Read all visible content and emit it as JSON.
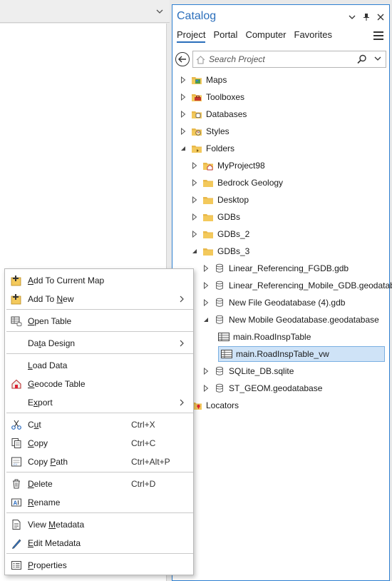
{
  "catalog": {
    "title": "Catalog",
    "tabs": [
      "Project",
      "Portal",
      "Computer",
      "Favorites"
    ],
    "active_tab": "Project",
    "search_placeholder": "Search Project",
    "tree": [
      {
        "label": "Maps",
        "icon": "maps-folder-icon",
        "expanded": false
      },
      {
        "label": "Toolboxes",
        "icon": "toolbox-folder-icon",
        "expanded": false
      },
      {
        "label": "Databases",
        "icon": "database-folder-icon",
        "expanded": false
      },
      {
        "label": "Styles",
        "icon": "styles-folder-icon",
        "expanded": false
      },
      {
        "label": "Folders",
        "icon": "folders-icon",
        "expanded": true
      },
      {
        "label": "MyProject98",
        "icon": "home-folder-icon",
        "expanded": false
      },
      {
        "label": "Bedrock Geology",
        "icon": "folder-icon",
        "expanded": false
      },
      {
        "label": "Desktop",
        "icon": "folder-icon",
        "expanded": false
      },
      {
        "label": "GDBs",
        "icon": "folder-icon",
        "expanded": false
      },
      {
        "label": "GDBs_2",
        "icon": "folder-icon",
        "expanded": false
      },
      {
        "label": "GDBs_3",
        "icon": "folder-icon",
        "expanded": true
      },
      {
        "label": "Linear_Referencing_FGDB.gdb",
        "icon": "geodatabase-icon",
        "expanded": false
      },
      {
        "label": "Linear_Referencing_Mobile_GDB.geodatabase",
        "icon": "geodatabase-icon",
        "expanded": false
      },
      {
        "label": "New File Geodatabase (4).gdb",
        "icon": "geodatabase-icon",
        "expanded": false
      },
      {
        "label": "New Mobile Geodatabase.geodatabase",
        "icon": "geodatabase-icon",
        "expanded": true
      },
      {
        "label": "main.RoadInspTable",
        "icon": "table-icon",
        "expanded": false
      },
      {
        "label": "main.RoadInspTable_vw",
        "icon": "table-icon",
        "selected": true
      },
      {
        "label": "SQLite_DB.sqlite",
        "icon": "geodatabase-icon",
        "expanded": false
      },
      {
        "label": "ST_GEOM.geodatabase",
        "icon": "geodatabase-icon",
        "expanded": false
      },
      {
        "label": "Locators",
        "icon": "locators-folder-icon",
        "expanded": false
      }
    ]
  },
  "context_menu": {
    "items": [
      {
        "pre": "",
        "ul": "A",
        "post": "dd To Current Map",
        "shortcut": "",
        "icon": "add-to-map-icon",
        "submenu": false
      },
      {
        "pre": "Add To ",
        "ul": "N",
        "post": "ew",
        "shortcut": "",
        "icon": "add-to-new-icon",
        "submenu": true
      },
      {
        "pre": "",
        "ul": "O",
        "post": "pen Table",
        "shortcut": "",
        "icon": "open-table-icon",
        "submenu": false
      },
      {
        "pre": "Da",
        "ul": "t",
        "post": "a Design",
        "shortcut": "",
        "icon": "",
        "submenu": true
      },
      {
        "pre": "",
        "ul": "L",
        "post": "oad Data",
        "shortcut": "",
        "icon": "",
        "submenu": false
      },
      {
        "pre": "",
        "ul": "G",
        "post": "eocode Table",
        "shortcut": "",
        "icon": "geocode-icon",
        "submenu": false
      },
      {
        "pre": "E",
        "ul": "x",
        "post": "port",
        "shortcut": "",
        "icon": "",
        "submenu": true
      },
      {
        "pre": "C",
        "ul": "u",
        "post": "t",
        "shortcut": "Ctrl+X",
        "icon": "cut-icon",
        "submenu": false
      },
      {
        "pre": "",
        "ul": "C",
        "post": "opy",
        "shortcut": "Ctrl+C",
        "icon": "copy-icon",
        "submenu": false
      },
      {
        "pre": "Copy ",
        "ul": "P",
        "post": "ath",
        "shortcut": "Ctrl+Alt+P",
        "icon": "copy-path-icon",
        "submenu": false
      },
      {
        "pre": "",
        "ul": "D",
        "post": "elete",
        "shortcut": "Ctrl+D",
        "icon": "delete-icon",
        "submenu": false
      },
      {
        "pre": "",
        "ul": "R",
        "post": "ename",
        "shortcut": "",
        "icon": "rename-icon",
        "submenu": false
      },
      {
        "pre": "View ",
        "ul": "M",
        "post": "etadata",
        "shortcut": "",
        "icon": "view-metadata-icon",
        "submenu": false
      },
      {
        "pre": "",
        "ul": "E",
        "post": "dit Metadata",
        "shortcut": "",
        "icon": "edit-metadata-icon",
        "submenu": false
      },
      {
        "pre": "",
        "ul": "P",
        "post": "roperties",
        "shortcut": "",
        "icon": "properties-icon",
        "submenu": false
      }
    ]
  },
  "colors": {
    "accent": "#2a6ebb",
    "selection": "#cfe3f7",
    "folder": "#e8b84a"
  }
}
